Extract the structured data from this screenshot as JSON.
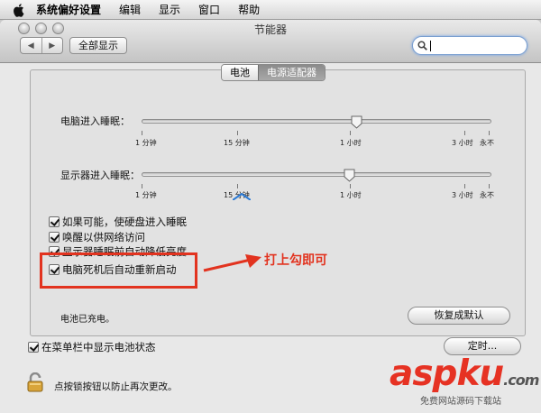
{
  "menubar": {
    "app_name": "系统偏好设置",
    "items": [
      "编辑",
      "显示",
      "窗口",
      "帮助"
    ]
  },
  "window": {
    "title": "节能器",
    "show_all_label": "全部显示",
    "search_placeholder": ""
  },
  "tabs": [
    {
      "label": "电池",
      "active": true
    },
    {
      "label": "电源适配器",
      "active": false
    }
  ],
  "computer_sleep": {
    "label": "电脑进入睡眠：",
    "ticks": [
      "1 分钟",
      "15 分钟",
      "1 小时",
      "3 小时",
      "永不"
    ]
  },
  "display_sleep": {
    "label": "显示器进入睡眠：",
    "ticks": [
      "1 分钟",
      "15 分钟",
      "1 小时",
      "3 小时",
      "永不"
    ]
  },
  "options": [
    {
      "label": "如果可能，使硬盘进入睡眠",
      "checked": true
    },
    {
      "label": "唤醒以供网络访问",
      "checked": true
    },
    {
      "label": "显示器睡眠前自动降低亮度",
      "checked": true
    },
    {
      "label": "电脑死机后自动重新启动",
      "checked": true
    }
  ],
  "annotation": "打上勾即可",
  "battery_status": "电池已充电。",
  "restore_defaults_label": "恢复成默认",
  "show_battery_menu": {
    "label": "在菜单栏中显示电池状态",
    "checked": true
  },
  "schedule_label": "定时...",
  "lock_text": "点按锁按钮以防止再次更改。",
  "watermark": {
    "main": "aspku",
    "suffix": ".com",
    "sub": "免费网站源码下载站"
  },
  "colors": {
    "annotation": "#e2331f",
    "watermark": "#e63223"
  }
}
